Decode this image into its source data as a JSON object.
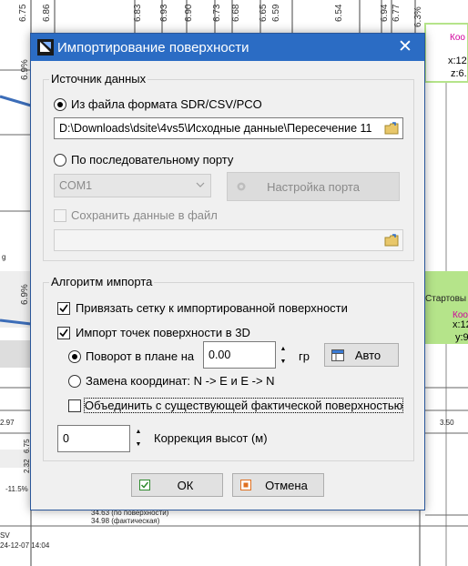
{
  "background": {
    "top_values": [
      "6.75",
      "6.86",
      "6.83",
      "6.93",
      "6.90",
      "6.73",
      "6.68",
      "6.65",
      "6.59",
      "6.54",
      "6.94",
      "6.77",
      "6.3%"
    ],
    "right_label_1": "Коо",
    "right_label_2": "x:12",
    "right_label_3": "z:6.",
    "right_label_4": "Стартовы",
    "right_label_5": "Коо",
    "right_label_6": "x:12",
    "right_label_7": "y:9",
    "left_values": [
      "6.9%",
      "6.9%",
      "2.97",
      "6.75",
      "2.32",
      "-11.5%"
    ],
    "right_value": "3.50",
    "bottom_note_1": "34.63 (по поверхности)",
    "bottom_note_2": "34.98 (фактическая)",
    "bottom_left_1": "SV",
    "bottom_left_2": "24-12-07  14:04",
    "left_small": "g"
  },
  "dialog": {
    "title": "Импортирование поверхности",
    "close_glyph": "✕",
    "source_group": {
      "label": "Источник данных",
      "file_radio_label": "Из файла формата SDR/CSV/PCO",
      "file_path": "D:\\Downloads\\dsite\\4vs5\\Исходные данные\\Пересечение 11",
      "port_radio_label": "По последовательному порту",
      "port_combo_value": "COM1",
      "port_settings_button": "Настройка порта",
      "save_checkbox_label": "Сохранить данные в файл",
      "save_path": ""
    },
    "algorithm_group": {
      "label": "Алгоритм импорта",
      "bind_grid_label": "Привязать сетку к импортированной поверхности",
      "import_3d_label": "Импорт точек поверхности в 3D",
      "rotation_label": "Поворот в плане на",
      "rotation_value": "0.00",
      "rotation_unit": "гр",
      "auto_button": "Авто",
      "swap_label": "Замена координат: N -> E и E -> N",
      "merge_label": "Объединить с существующей фактической поверхностью",
      "elevation_value": "0",
      "elevation_label": "Коррекция высот (м)"
    },
    "ok_button": "ОК",
    "cancel_button": "Отмена"
  },
  "colors": {
    "titlebar": "#2b6cc4",
    "highlight_green": "#b5e48a",
    "label_magenta": "#d0009c"
  },
  "state": {
    "file_radio_selected": true,
    "port_radio_selected": false,
    "bind_grid_checked": true,
    "import_3d_checked": true,
    "rotation_radio_selected": true,
    "swap_radio_selected": false,
    "merge_checked": false,
    "save_checked": false
  }
}
